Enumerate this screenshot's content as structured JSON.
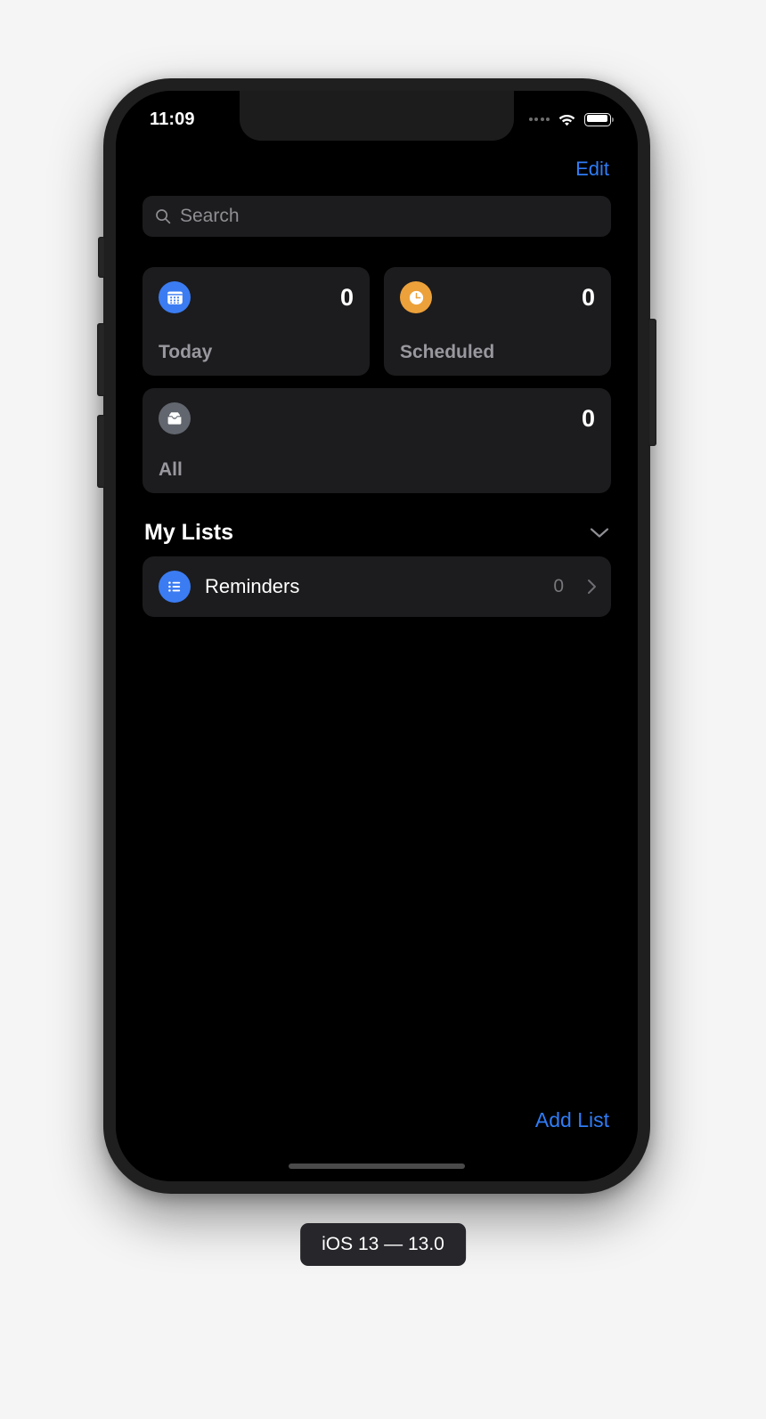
{
  "status_bar": {
    "time": "11:09",
    "signal_icon": "signal-dots-icon",
    "wifi_icon": "wifi-icon",
    "battery_icon": "battery-full-icon"
  },
  "nav": {
    "edit_label": "Edit"
  },
  "search": {
    "placeholder": "Search",
    "value": "",
    "icon": "search-icon"
  },
  "smart_lists": [
    {
      "id": "today",
      "label": "Today",
      "count": "0",
      "icon": "calendar-icon",
      "color": "#3b7cf2"
    },
    {
      "id": "scheduled",
      "label": "Scheduled",
      "count": "0",
      "icon": "clock-icon",
      "color": "#eda13a"
    },
    {
      "id": "all",
      "label": "All",
      "count": "0",
      "icon": "inbox-tray-icon",
      "color": "#62666e"
    }
  ],
  "my_lists": {
    "title": "My Lists",
    "collapse_icon": "chevron-down-icon",
    "items": [
      {
        "name": "Reminders",
        "count": "0",
        "icon": "bullet-list-icon",
        "color": "#3b7cf2",
        "disclosure_icon": "chevron-right-icon"
      }
    ]
  },
  "toolbar": {
    "add_list_label": "Add List"
  },
  "caption": {
    "text": "iOS 13 — 13.0"
  },
  "theme": {
    "page_background": "#f5f5f5",
    "frame": "#1f1f1f",
    "screen_background": "#000000",
    "card_background": "#1c1c1e",
    "accent_blue": "#2f7cf6",
    "secondary_text": "#98989e"
  }
}
